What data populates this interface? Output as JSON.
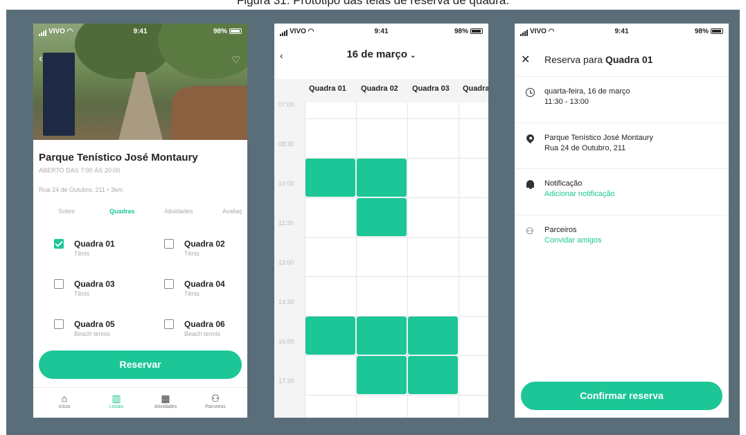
{
  "caption": "Figura 31: Protótipo das telas de reserva de quadra.",
  "status": {
    "carrier": "VIVO",
    "time": "9:41",
    "battery": "98%"
  },
  "venue": {
    "name": "Parque Tenístico José Montaury",
    "hours": "ABERTO DAS 7:00 ÀS 20:00",
    "address": "Rua 24 de Outubro, 211 • 3km"
  },
  "venue_tabs": [
    "Sobre",
    "Quadras",
    "Atividades",
    "Avaliaç"
  ],
  "courts": [
    {
      "name": "Quadra 01",
      "type": "Tênis",
      "checked": true
    },
    {
      "name": "Quadra 02",
      "type": "Tênis",
      "checked": false
    },
    {
      "name": "Quadra 03",
      "type": "Tênis",
      "checked": false
    },
    {
      "name": "Quadra 04",
      "type": "Tênis",
      "checked": false
    },
    {
      "name": "Quadra 05",
      "type": "Beach tennis",
      "checked": false
    },
    {
      "name": "Quadra 06",
      "type": "Beach tennis",
      "checked": false
    }
  ],
  "reserve_label": "Reservar",
  "bottom_nav": [
    {
      "label": "Início",
      "icon": "home-icon"
    },
    {
      "label": "Locais",
      "icon": "map-icon"
    },
    {
      "label": "Atividades",
      "icon": "calendar-icon"
    },
    {
      "label": "Parceiros",
      "icon": "people-icon"
    }
  ],
  "schedule": {
    "date": "16 de março",
    "columns": [
      "Quadra 01",
      "Quadra 02",
      "Quadra 03",
      "Quadra"
    ],
    "times": [
      "07:00",
      "08:30",
      "10:00",
      "11:30",
      "13:00",
      "14:30",
      "16:00",
      "17:30"
    ],
    "booked": [
      {
        "col": 0,
        "slot": 1
      },
      {
        "col": 1,
        "slot": 1
      },
      {
        "col": 1,
        "slot": 2
      },
      {
        "col": 0,
        "slot": 5
      },
      {
        "col": 1,
        "slot": 5
      },
      {
        "col": 2,
        "slot": 5
      },
      {
        "col": 1,
        "slot": 6
      },
      {
        "col": 2,
        "slot": 6
      }
    ]
  },
  "booking": {
    "title_prefix": "Reserva para",
    "title_court": "Quadra 01",
    "date_line": "quarta-feira, 16 de março",
    "time_line": "11:30 - 13:00",
    "place_line": "Parque Tenístico José Montaury",
    "street_line": "Rua 24 de Outubro, 211",
    "notification_label": "Notificação",
    "notification_link": "Adicionar notificação",
    "partners_label": "Parceiros",
    "partners_link": "Convidar amigos",
    "confirm_label": "Confirmar reserva"
  },
  "colors": {
    "accent": "#1cc696",
    "backdrop": "#5a6e7a"
  }
}
